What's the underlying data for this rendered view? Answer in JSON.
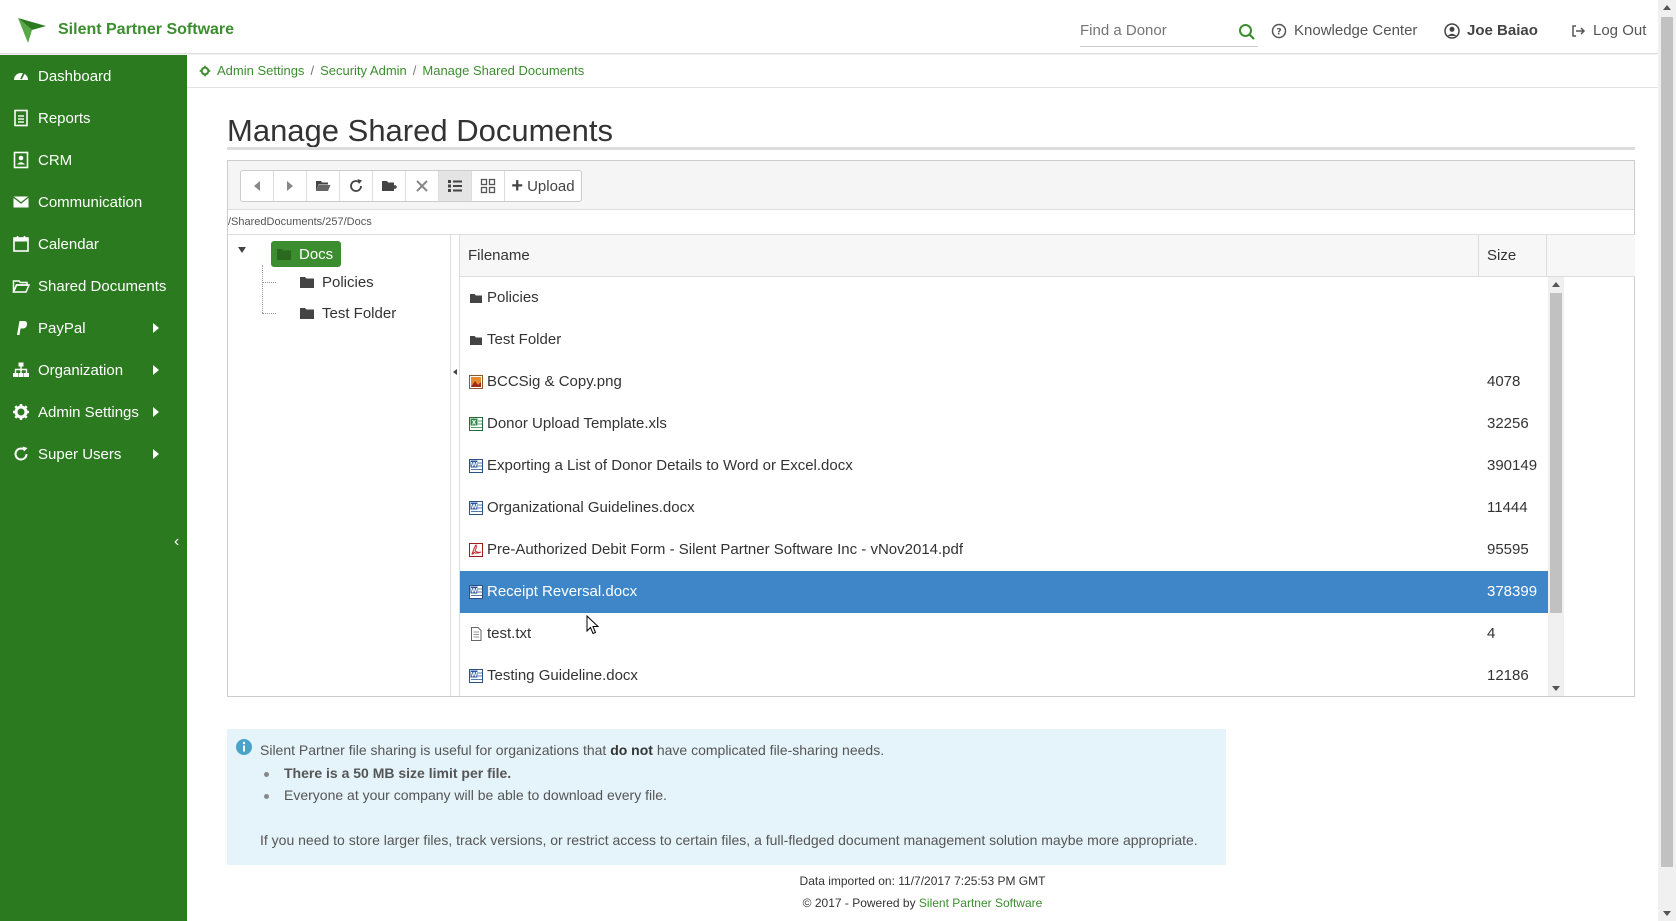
{
  "header": {
    "app_name": "Silent Partner Software",
    "search_placeholder": "Find a Donor",
    "knowledge_center": "Knowledge Center",
    "user_name": "Joe Baiao",
    "logout": "Log Out",
    "brand_color": "#2c7a20"
  },
  "sidebar": {
    "items": [
      {
        "label": "Dashboard",
        "icon": "dashboard-icon"
      },
      {
        "label": "Reports",
        "icon": "report-icon"
      },
      {
        "label": "CRM",
        "icon": "contact-card-icon"
      },
      {
        "label": "Communication",
        "icon": "envelope-icon"
      },
      {
        "label": "Calendar",
        "icon": "calendar-icon"
      },
      {
        "label": "Shared Documents",
        "icon": "folder-open-icon"
      },
      {
        "label": "PayPal",
        "icon": "paypal-icon",
        "submenu": true
      },
      {
        "label": "Organization",
        "icon": "sitemap-icon",
        "submenu": true
      },
      {
        "label": "Admin Settings",
        "icon": "gear-icon",
        "submenu": true
      },
      {
        "label": "Super Users",
        "icon": "refresh-icon",
        "submenu": true
      }
    ],
    "collapse": "‹"
  },
  "breadcrumb": {
    "items": [
      "Admin Settings",
      "Security Admin",
      "Manage Shared Documents"
    ],
    "sep": "/"
  },
  "page": {
    "title": "Manage Shared Documents"
  },
  "filemanager": {
    "upload_label": "Upload",
    "path": "/SharedDocuments/257/Docs",
    "tree": {
      "root": "Docs",
      "children": [
        "Policies",
        "Test Folder"
      ]
    },
    "columns": {
      "filename": "Filename",
      "size": "Size"
    },
    "files": [
      {
        "name": "Policies",
        "size": "",
        "type": "folder"
      },
      {
        "name": "Test Folder",
        "size": "",
        "type": "folder"
      },
      {
        "name": "BCCSig & Copy.png",
        "size": "4078",
        "type": "image"
      },
      {
        "name": "Donor Upload Template.xls",
        "size": "32256",
        "type": "excel"
      },
      {
        "name": "Exporting a List of Donor Details to Word or Excel.docx",
        "size": "390149",
        "type": "word"
      },
      {
        "name": "Organizational Guidelines.docx",
        "size": "11444",
        "type": "word"
      },
      {
        "name": "Pre-Authorized Debit Form - Silent Partner Software Inc - vNov2014.pdf",
        "size": "95595",
        "type": "pdf"
      },
      {
        "name": "Receipt Reversal.docx",
        "size": "378399",
        "type": "word",
        "selected": true
      },
      {
        "name": "test.txt",
        "size": "4",
        "type": "text"
      },
      {
        "name": "Testing Guideline.docx",
        "size": "12186",
        "type": "word"
      }
    ],
    "selected_color": "#3f86c8"
  },
  "info": {
    "line1_pre": "Silent Partner file sharing is useful for organizations that ",
    "line1_bold": "do not",
    "line1_post": " have complicated file-sharing needs.",
    "bullet1": "There is a 50 MB size limit per file.",
    "bullet2": "Everyone at your company will be able to download every file.",
    "line2": "If you need to store larger files, track versions, or restrict access to certain files, a full-fledged document management solution maybe more appropriate."
  },
  "footer": {
    "imported": "Data imported on: 11/7/2017 7:25:53 PM GMT",
    "copyright": "© 2017 - Powered by ",
    "powered_link": "Silent Partner Software"
  }
}
